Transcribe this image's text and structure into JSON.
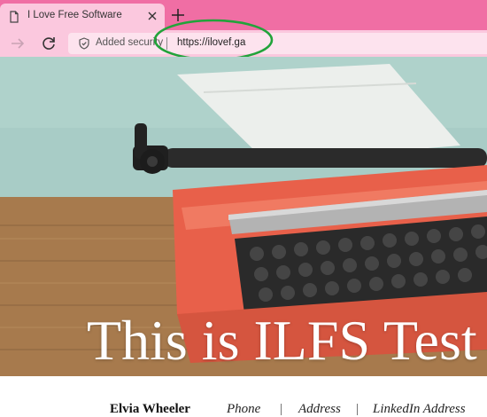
{
  "browser": {
    "tab": {
      "title": "I Love Free Software",
      "favicon": "page-icon",
      "close_icon": "close-icon"
    },
    "new_tab_icon": "plus-icon",
    "toolbar": {
      "back_icon": "arrow-right-icon",
      "reload_icon": "reload-icon",
      "security_icon": "shield-icon",
      "security_text": "Added security",
      "url": "https://ilovef.ga"
    },
    "colors": {
      "tabstrip": "#f06ea4",
      "toolbar": "#fbc8de",
      "annotation_circle": "#22a33a"
    }
  },
  "page": {
    "hero_title": "This is ILFS Test",
    "contact": {
      "name": "Elvia Wheeler",
      "phone": "Phone",
      "address": "Address",
      "linkedin": "LinkedIn Address"
    }
  }
}
